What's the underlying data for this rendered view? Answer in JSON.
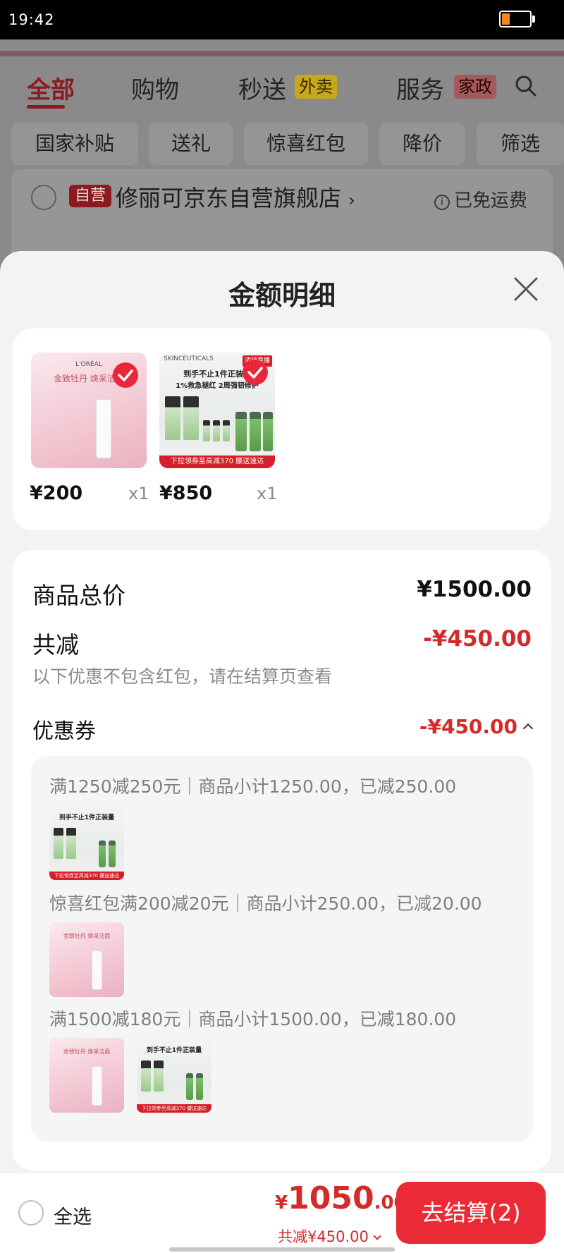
{
  "status_bar": {
    "time": "19:42",
    "battery_level": 0.3
  },
  "background": {
    "tabs": [
      "全部",
      "购物",
      "秒送",
      "服务"
    ],
    "tab_badges": {
      "miaosong": "外卖",
      "fuwu": "家政"
    },
    "chips": [
      "国家补贴",
      "送礼",
      "惊喜红包",
      "降价",
      "筛选"
    ],
    "store": {
      "badge": "自营",
      "name": "修丽可京东自营旗舰店",
      "arrow": "›",
      "shipping": "已免运费"
    }
  },
  "sheet": {
    "title": "金额明细",
    "products": [
      {
        "price": "¥200",
        "qty": "x1",
        "brand": "L'ORÉAL",
        "caption": "金致牡丹 焕采洁面",
        "color": "#f3c9d4"
      },
      {
        "price": "¥850",
        "qty": "x1",
        "brand": "SKINCEUTICALS",
        "tag": "浓销直播",
        "line1": "到手不止1件正装量",
        "line2": "1%救急褪红 2周强韧修护",
        "promo": "下拉领券至高减370 腰送速达",
        "color": "#7dbf6a"
      }
    ],
    "summary": {
      "total_label": "商品总价",
      "total_value": "¥1500.00",
      "discount_label": "共减",
      "discount_value": "-¥450.00",
      "note": "以下优惠不包含红包，请在结算页查看",
      "coupon_label": "优惠券",
      "coupon_value": "-¥450.00"
    },
    "coupons": [
      {
        "text": "满1250减250元｜商品小计1250.00，已减250.00"
      },
      {
        "text": "惊喜红包满200减20元｜商品小计250.00，已减20.00"
      },
      {
        "text": "满1500减180元｜商品小计1500.00，已减180.00"
      }
    ]
  },
  "bottom_bar": {
    "select_all": "全选",
    "currency": "¥",
    "total_int": "1050",
    "total_dec": ".00",
    "discount": "共减¥450.00",
    "checkout": "去结算(2)"
  },
  "colors": {
    "accent_red": "#d42a2a",
    "button_red": "#ea2a35",
    "check_red": "#e8283a"
  }
}
